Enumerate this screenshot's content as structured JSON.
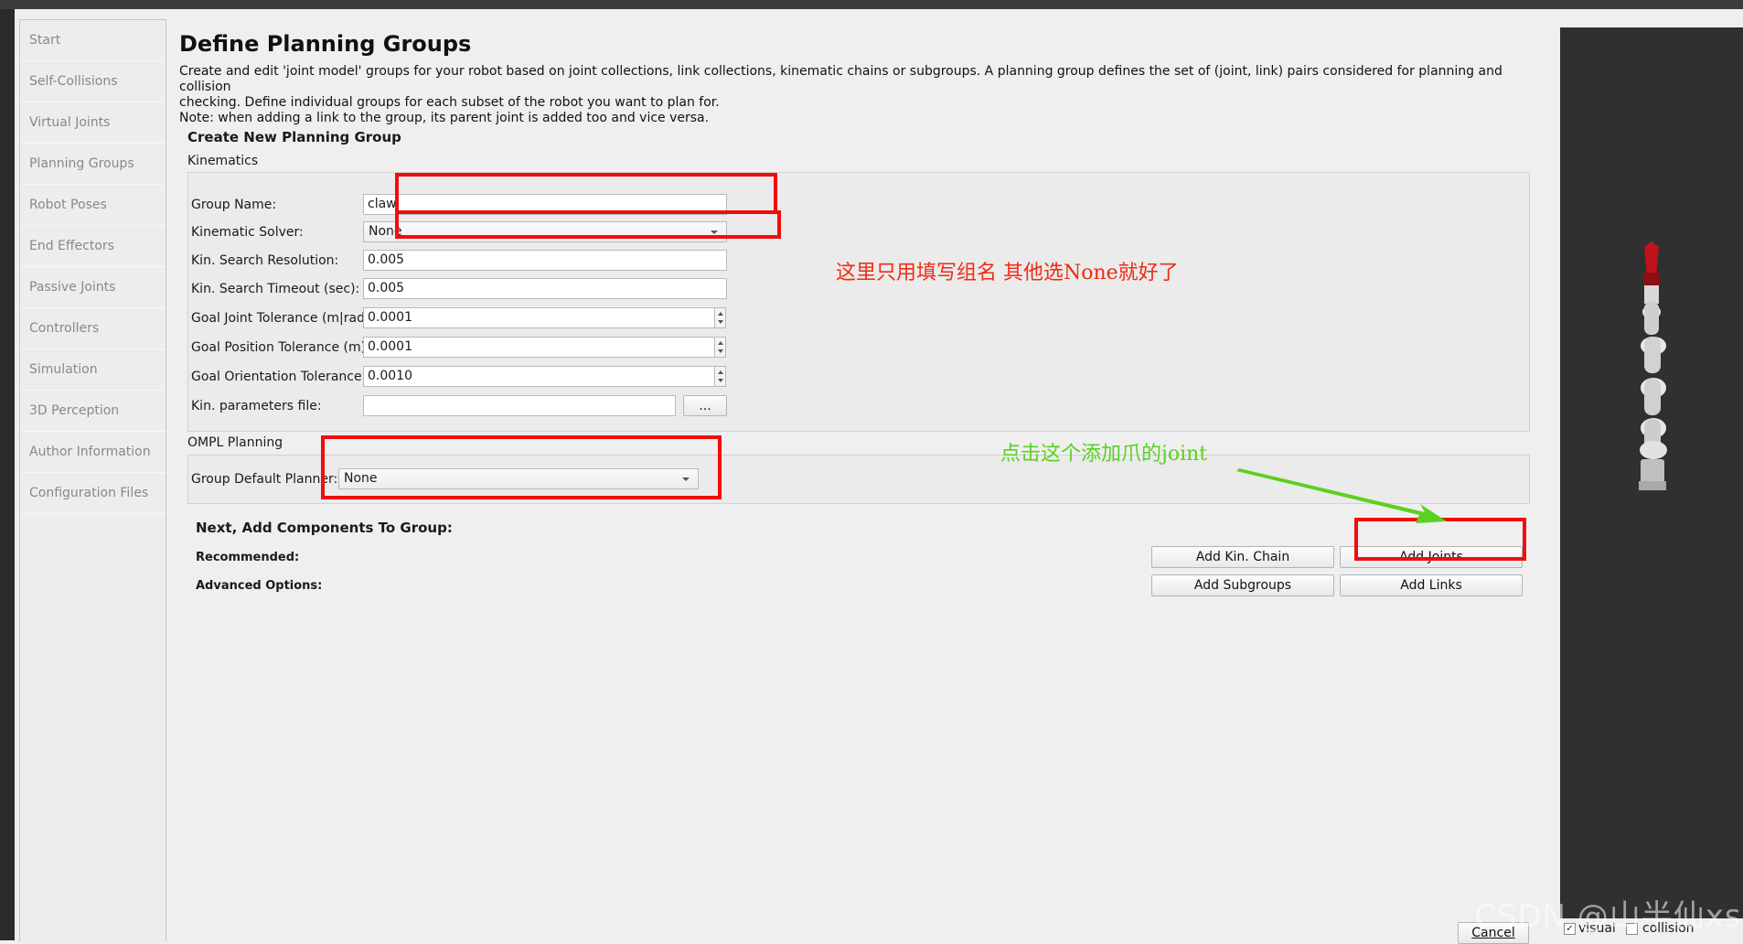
{
  "sidebar": {
    "items": [
      {
        "label": "Start"
      },
      {
        "label": "Self-Collisions"
      },
      {
        "label": "Virtual Joints"
      },
      {
        "label": "Planning Groups"
      },
      {
        "label": "Robot Poses"
      },
      {
        "label": "End Effectors"
      },
      {
        "label": "Passive Joints"
      },
      {
        "label": "Controllers"
      },
      {
        "label": "Simulation"
      },
      {
        "label": "3D Perception"
      },
      {
        "label": "Author Information"
      },
      {
        "label": "Configuration Files"
      }
    ]
  },
  "main": {
    "title": "Define Planning Groups",
    "description": [
      "Create and edit 'joint model' groups for your robot based on joint collections, link collections, kinematic chains or subgroups. A planning group defines the set of (joint, link) pairs considered for planning and collision",
      "checking. Define individual groups for each subset of the robot you want to plan for.",
      "Note: when adding a link to the group, its parent joint is added too and vice versa."
    ],
    "create_title": "Create New Planning Group",
    "kinematics_label": "Kinematics",
    "fields": {
      "group_name": {
        "label": "Group Name:",
        "value": "claw"
      },
      "kinematic_solver": {
        "label": "Kinematic Solver:",
        "value": "None"
      },
      "search_resolution": {
        "label": "Kin. Search Resolution:",
        "value": "0.005"
      },
      "search_timeout": {
        "label": "Kin. Search Timeout (sec):",
        "value": "0.005"
      },
      "goal_joint_tol": {
        "label": "Goal Joint Tolerance (m|rad):",
        "value": "0.0001"
      },
      "goal_position_tol": {
        "label": "Goal Position Tolerance (m):",
        "value": "0.0001"
      },
      "goal_orientation_tol": {
        "label": "Goal Orientation Tolerance (rad):",
        "value": "0.0010"
      },
      "params_file": {
        "label": "Kin. parameters file:",
        "value": "",
        "browse_label": "..."
      }
    },
    "ompl_label": "OMPL Planning",
    "default_planner": {
      "label": "Group Default Planner:",
      "value": "None"
    },
    "components_title": "Next, Add Components To Group:",
    "recommended_label": "Recommended:",
    "advanced_label": "Advanced Options:",
    "buttons": {
      "add_kin_chain": "Add Kin. Chain",
      "add_joints": "Add Joints",
      "add_subgroups": "Add Subgroups",
      "add_links": "Add Links",
      "cancel": "Cancel"
    }
  },
  "annotations": {
    "red_note": "这里只用填写组名 其他选None就好了",
    "green_note": "点击这个添加爪的joint",
    "red_color": "#f00d0d",
    "green_color": "#5ad11f"
  },
  "viewer": {
    "visual_label": "visual",
    "visual_checked": true,
    "collision_label": "collision",
    "collision_checked": false
  },
  "watermark": "CSDN @山半仙xs"
}
